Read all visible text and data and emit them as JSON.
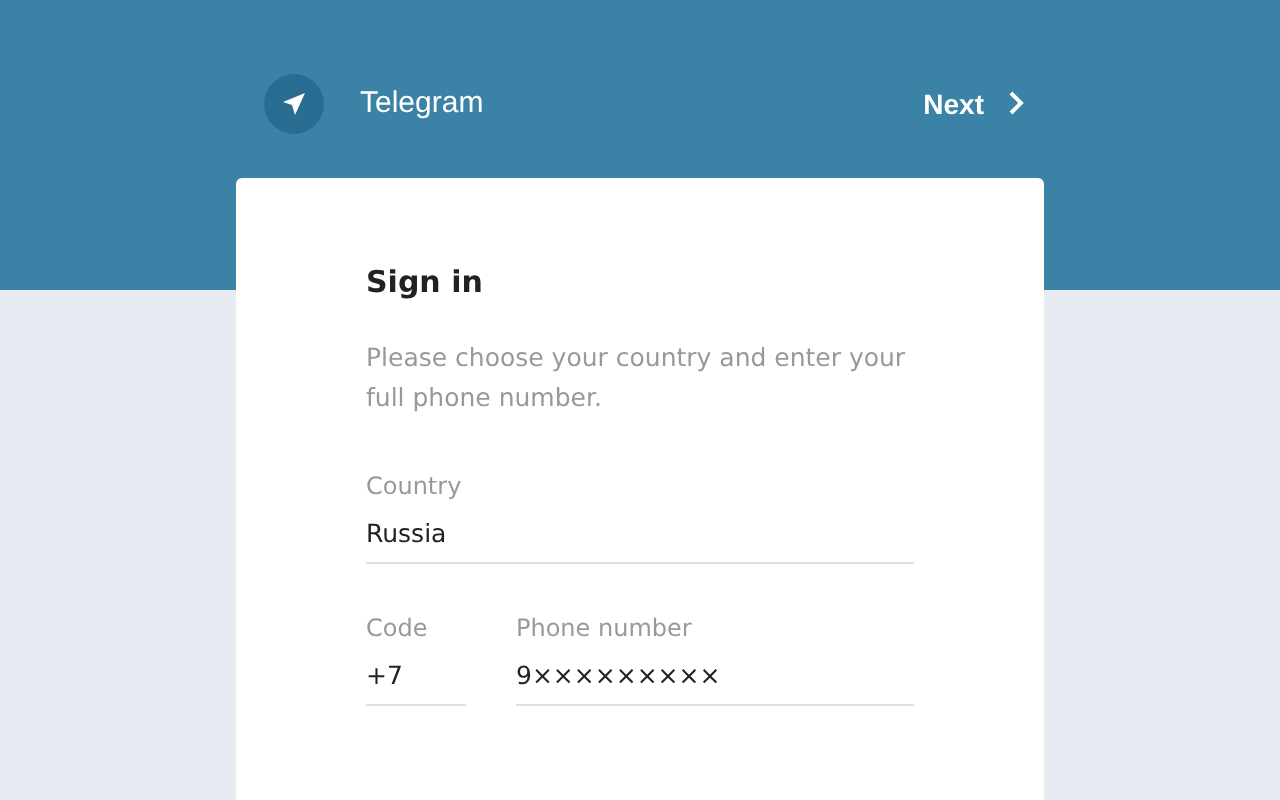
{
  "header": {
    "app_name": "Telegram",
    "next_label": "Next"
  },
  "card": {
    "title": "Sign in",
    "description": "Please choose your country and enter your full phone number.",
    "country": {
      "label": "Country",
      "value": "Russia"
    },
    "code": {
      "label": "Code",
      "value": "+7"
    },
    "phone": {
      "label": "Phone number",
      "value": "9×××××××××"
    }
  }
}
